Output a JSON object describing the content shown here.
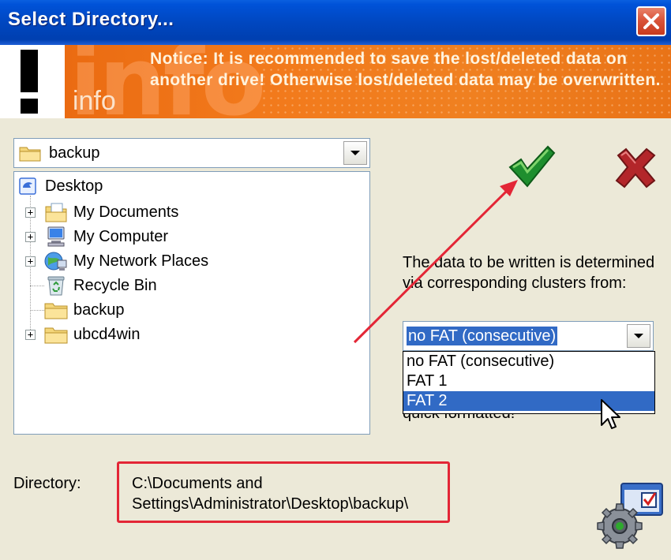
{
  "window": {
    "title": "Select Directory...",
    "close_label": "Close"
  },
  "banner": {
    "badge": "!",
    "watermark": "info",
    "info_label": "info",
    "notice": "Notice: It is recommended to save the lost/deleted data on another drive! Otherwise lost/deleted data may be overwritten."
  },
  "folder_combo": {
    "value": "backup"
  },
  "tree": {
    "items": [
      {
        "label": "Desktop",
        "icon": "desktop-icon"
      },
      {
        "label": "My Documents",
        "icon": "my-documents-icon"
      },
      {
        "label": "My Computer",
        "icon": "my-computer-icon"
      },
      {
        "label": "My Network Places",
        "icon": "network-places-icon"
      },
      {
        "label": "Recycle Bin",
        "icon": "recycle-bin-icon"
      },
      {
        "label": "backup",
        "icon": "folder-icon"
      },
      {
        "label": "ubcd4win",
        "icon": "folder-icon"
      }
    ],
    "expander_symbol": "+"
  },
  "actions": {
    "ok_icon": "green-checkmark-icon",
    "cancel_icon": "red-x-icon"
  },
  "clusters": {
    "description": "The data to be written is determined via corresponding clusters from:",
    "selected": "no FAT (consecutive)",
    "options": [
      "no FAT (consecutive)",
      "FAT 1",
      "FAT 2"
    ],
    "highlighted_option": "FAT 2",
    "hidden_text": "quick formatted!"
  },
  "directory": {
    "label": "Directory:",
    "path_line1": "C:\\Documents and",
    "path_line2": "Settings\\Administrator\\Desktop\\backup\\"
  },
  "colors": {
    "titlebar": "#0047C0",
    "banner": "#F07A1C",
    "annotation_red": "#E32636",
    "selection_blue": "#316AC5"
  }
}
